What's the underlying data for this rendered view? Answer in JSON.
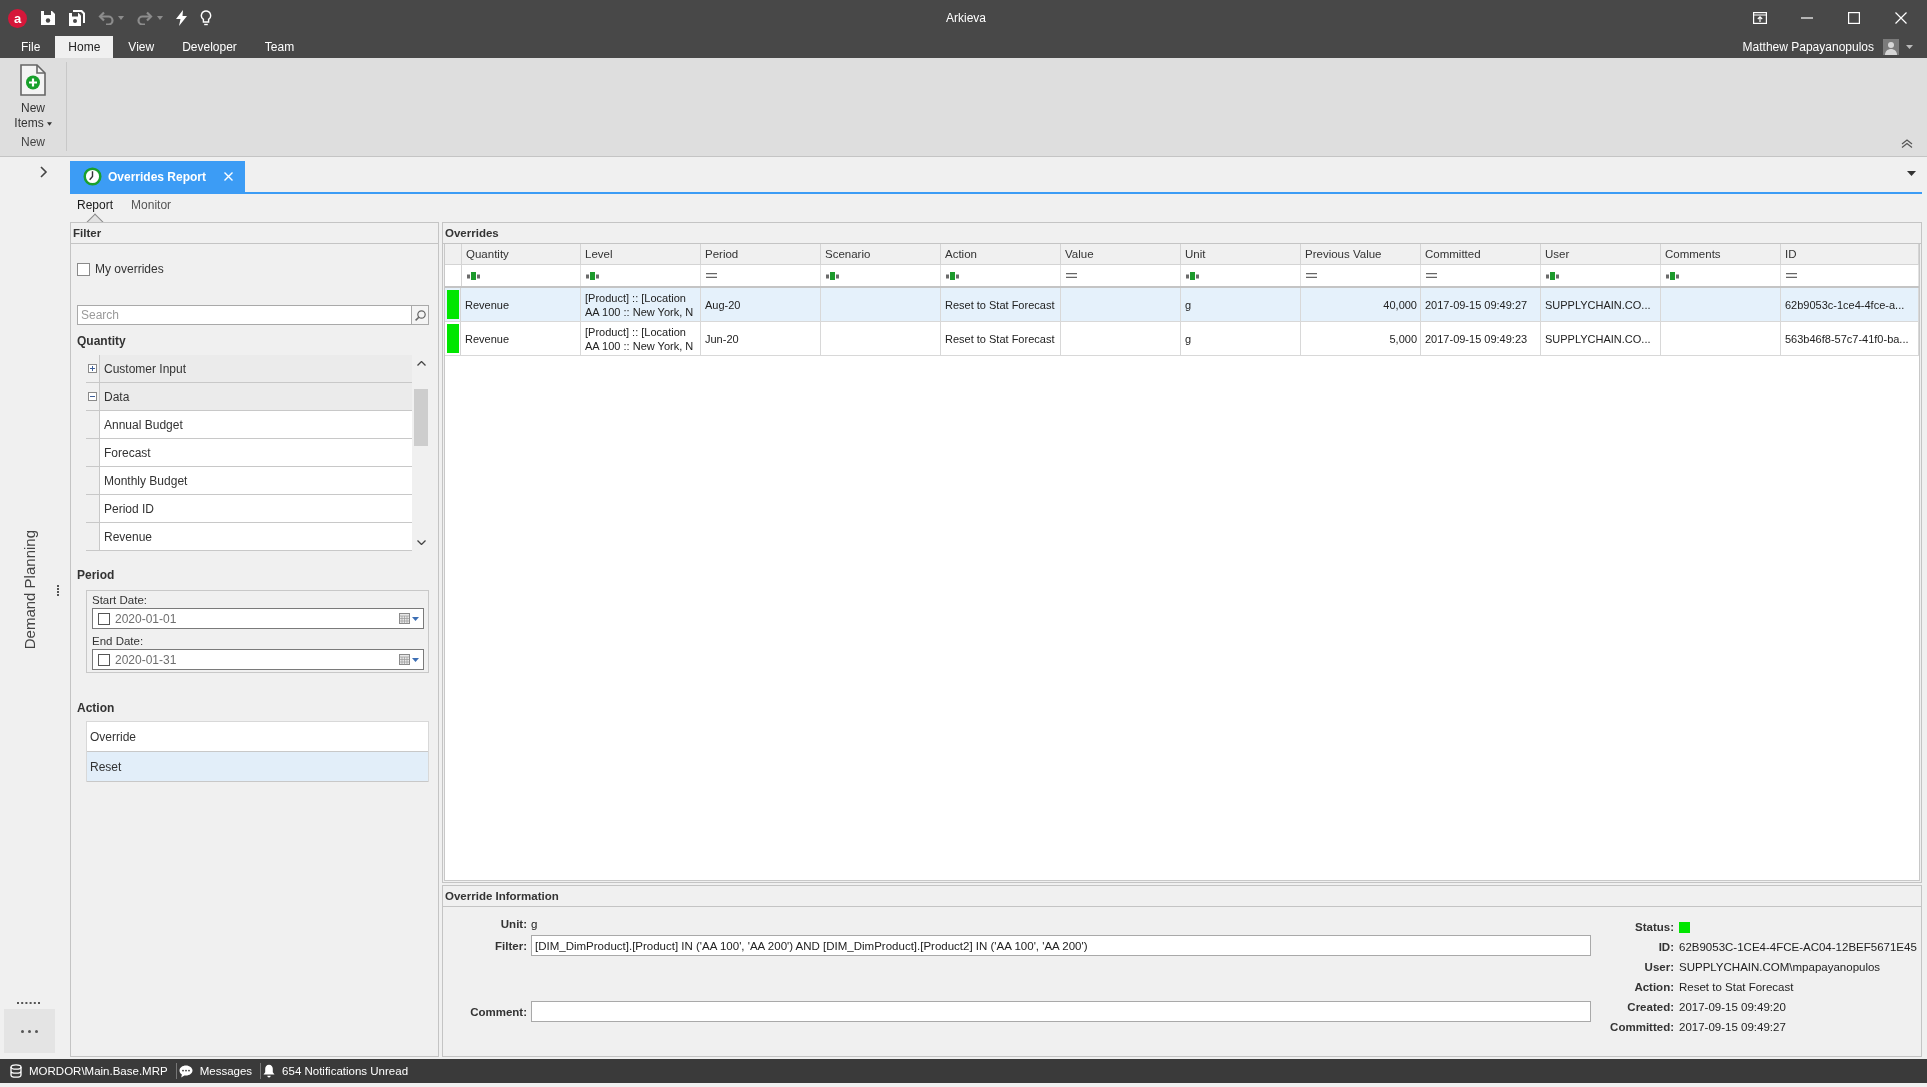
{
  "window": {
    "logo": "a",
    "title": "Arkieva",
    "user_name": "Matthew Papayanopulos"
  },
  "quick_access": [
    {
      "kind": "save",
      "disabled": false,
      "dropdown": false
    },
    {
      "kind": "save_all",
      "disabled": false,
      "dropdown": false
    },
    {
      "kind": "undo",
      "disabled": true,
      "dropdown": true
    },
    {
      "kind": "redo",
      "disabled": true,
      "dropdown": true
    },
    {
      "kind": "run",
      "disabled": false,
      "dropdown": false
    },
    {
      "kind": "tips",
      "disabled": false,
      "dropdown": false
    }
  ],
  "menu_tabs": [
    {
      "label": "File",
      "selected": false
    },
    {
      "label": "Home",
      "selected": true
    },
    {
      "label": "View",
      "selected": false
    },
    {
      "label": "Developer",
      "selected": false
    },
    {
      "label": "Team",
      "selected": false
    }
  ],
  "ribbon": {
    "groups": [
      {
        "label": "New",
        "buttons": [
          {
            "kind": "new_items",
            "label": "New Items",
            "dropdown": true
          }
        ]
      }
    ]
  },
  "side_nav": {
    "label": "Demand Planning"
  },
  "document_tabs": [
    {
      "label": "Overrides Report",
      "selected": true
    }
  ],
  "view_tabs": [
    {
      "label": "Report",
      "selected": true
    },
    {
      "label": "Monitor",
      "selected": false
    }
  ],
  "filter": {
    "title": "Filter",
    "my_overrides": {
      "label": "My overrides",
      "checked": false
    },
    "search": {
      "placeholder": "Search"
    },
    "quantity": {
      "title": "Quantity",
      "tree": [
        {
          "label": "Customer Input",
          "expanded": false
        },
        {
          "label": "Data",
          "expanded": true,
          "children": [
            {
              "label": "Annual Budget"
            },
            {
              "label": "Forecast"
            },
            {
              "label": "Monthly Budget"
            },
            {
              "label": "Period ID"
            },
            {
              "label": "Revenue"
            }
          ]
        }
      ]
    },
    "period": {
      "title": "Period",
      "fields": [
        {
          "label": "Start Date:",
          "value": "2020-01-01",
          "checked": false
        },
        {
          "label": "End Date:",
          "value": "2020-01-31",
          "checked": false
        }
      ]
    },
    "action": {
      "title": "Action",
      "items": [
        {
          "label": "Override",
          "selected": false
        },
        {
          "label": "Reset",
          "selected": true
        }
      ]
    }
  },
  "overrides": {
    "title": "Overrides",
    "columns": [
      {
        "label": "Quantity",
        "kind": "text"
      },
      {
        "label": "Level",
        "kind": "text"
      },
      {
        "label": "Period",
        "kind": "equals"
      },
      {
        "label": "Scenario",
        "kind": "text"
      },
      {
        "label": "Action",
        "kind": "text"
      },
      {
        "label": "Value",
        "kind": "equals"
      },
      {
        "label": "Unit",
        "kind": "text"
      },
      {
        "label": "Previous Value",
        "kind": "equals"
      },
      {
        "label": "Committed",
        "kind": "equals"
      },
      {
        "label": "User",
        "kind": "text"
      },
      {
        "label": "Comments",
        "kind": "text"
      },
      {
        "label": "ID",
        "kind": "equals"
      }
    ],
    "rows": [
      {
        "selected": true,
        "color": "#00e600",
        "quantity": "Revenue",
        "level": "[Product] :: [Location\nAA 100 :: New York, N",
        "period": "Aug-20",
        "action": "Reset to Stat Forecast",
        "unit": "g",
        "previous_value": "40,000",
        "committed": "2017-09-15 09:49:27",
        "user": "SUPPLYCHAIN.CO...",
        "id": "62b9053c-1ce4-4fce-a..."
      },
      {
        "selected": false,
        "color": "#00e600",
        "quantity": "Revenue",
        "level": "[Product] :: [Location\nAA 100 :: New York, N",
        "period": "Jun-20",
        "action": "Reset to Stat Forecast",
        "unit": "g",
        "previous_value": "5,000",
        "committed": "2017-09-15 09:49:23",
        "user": "SUPPLYCHAIN.CO...",
        "id": "563b46f8-57c7-41f0-ba..."
      }
    ]
  },
  "override_information": {
    "title": "Override Information",
    "fields": [
      {
        "kind": "text",
        "label": "Unit:",
        "value": "g"
      },
      {
        "kind": "field",
        "label": "Filter:",
        "value": "[DIM_DimProduct].[Product] IN ('AA 100', 'AA 200') AND [DIM_DimProduct].[Product2] IN ('AA 100', 'AA 200')"
      },
      {
        "kind": "field",
        "label": "Comment:"
      }
    ],
    "details": [
      {
        "kind": "status",
        "label": "Status:",
        "color": "#00e600"
      },
      {
        "kind": "text",
        "label": "ID:",
        "value": "62B9053C-1CE4-4FCE-AC04-12BEF5671E45"
      },
      {
        "kind": "text",
        "label": "User:",
        "value": "SUPPLYCHAIN.COM\\mpapayanopulos"
      },
      {
        "kind": "text",
        "label": "Action:",
        "value": "Reset to Stat Forecast"
      },
      {
        "kind": "text",
        "label": "Created:",
        "value": "2017-09-15 09:49:20"
      },
      {
        "kind": "text",
        "label": "Committed:",
        "value": "2017-09-15 09:49:27"
      }
    ]
  },
  "status_bar": [
    {
      "kind": "database",
      "label": "MORDOR\\Main.Base.MRP"
    },
    {
      "kind": "messages",
      "label": "Messages"
    },
    {
      "kind": "notifications",
      "label": "654 Notifications Unread"
    }
  ]
}
